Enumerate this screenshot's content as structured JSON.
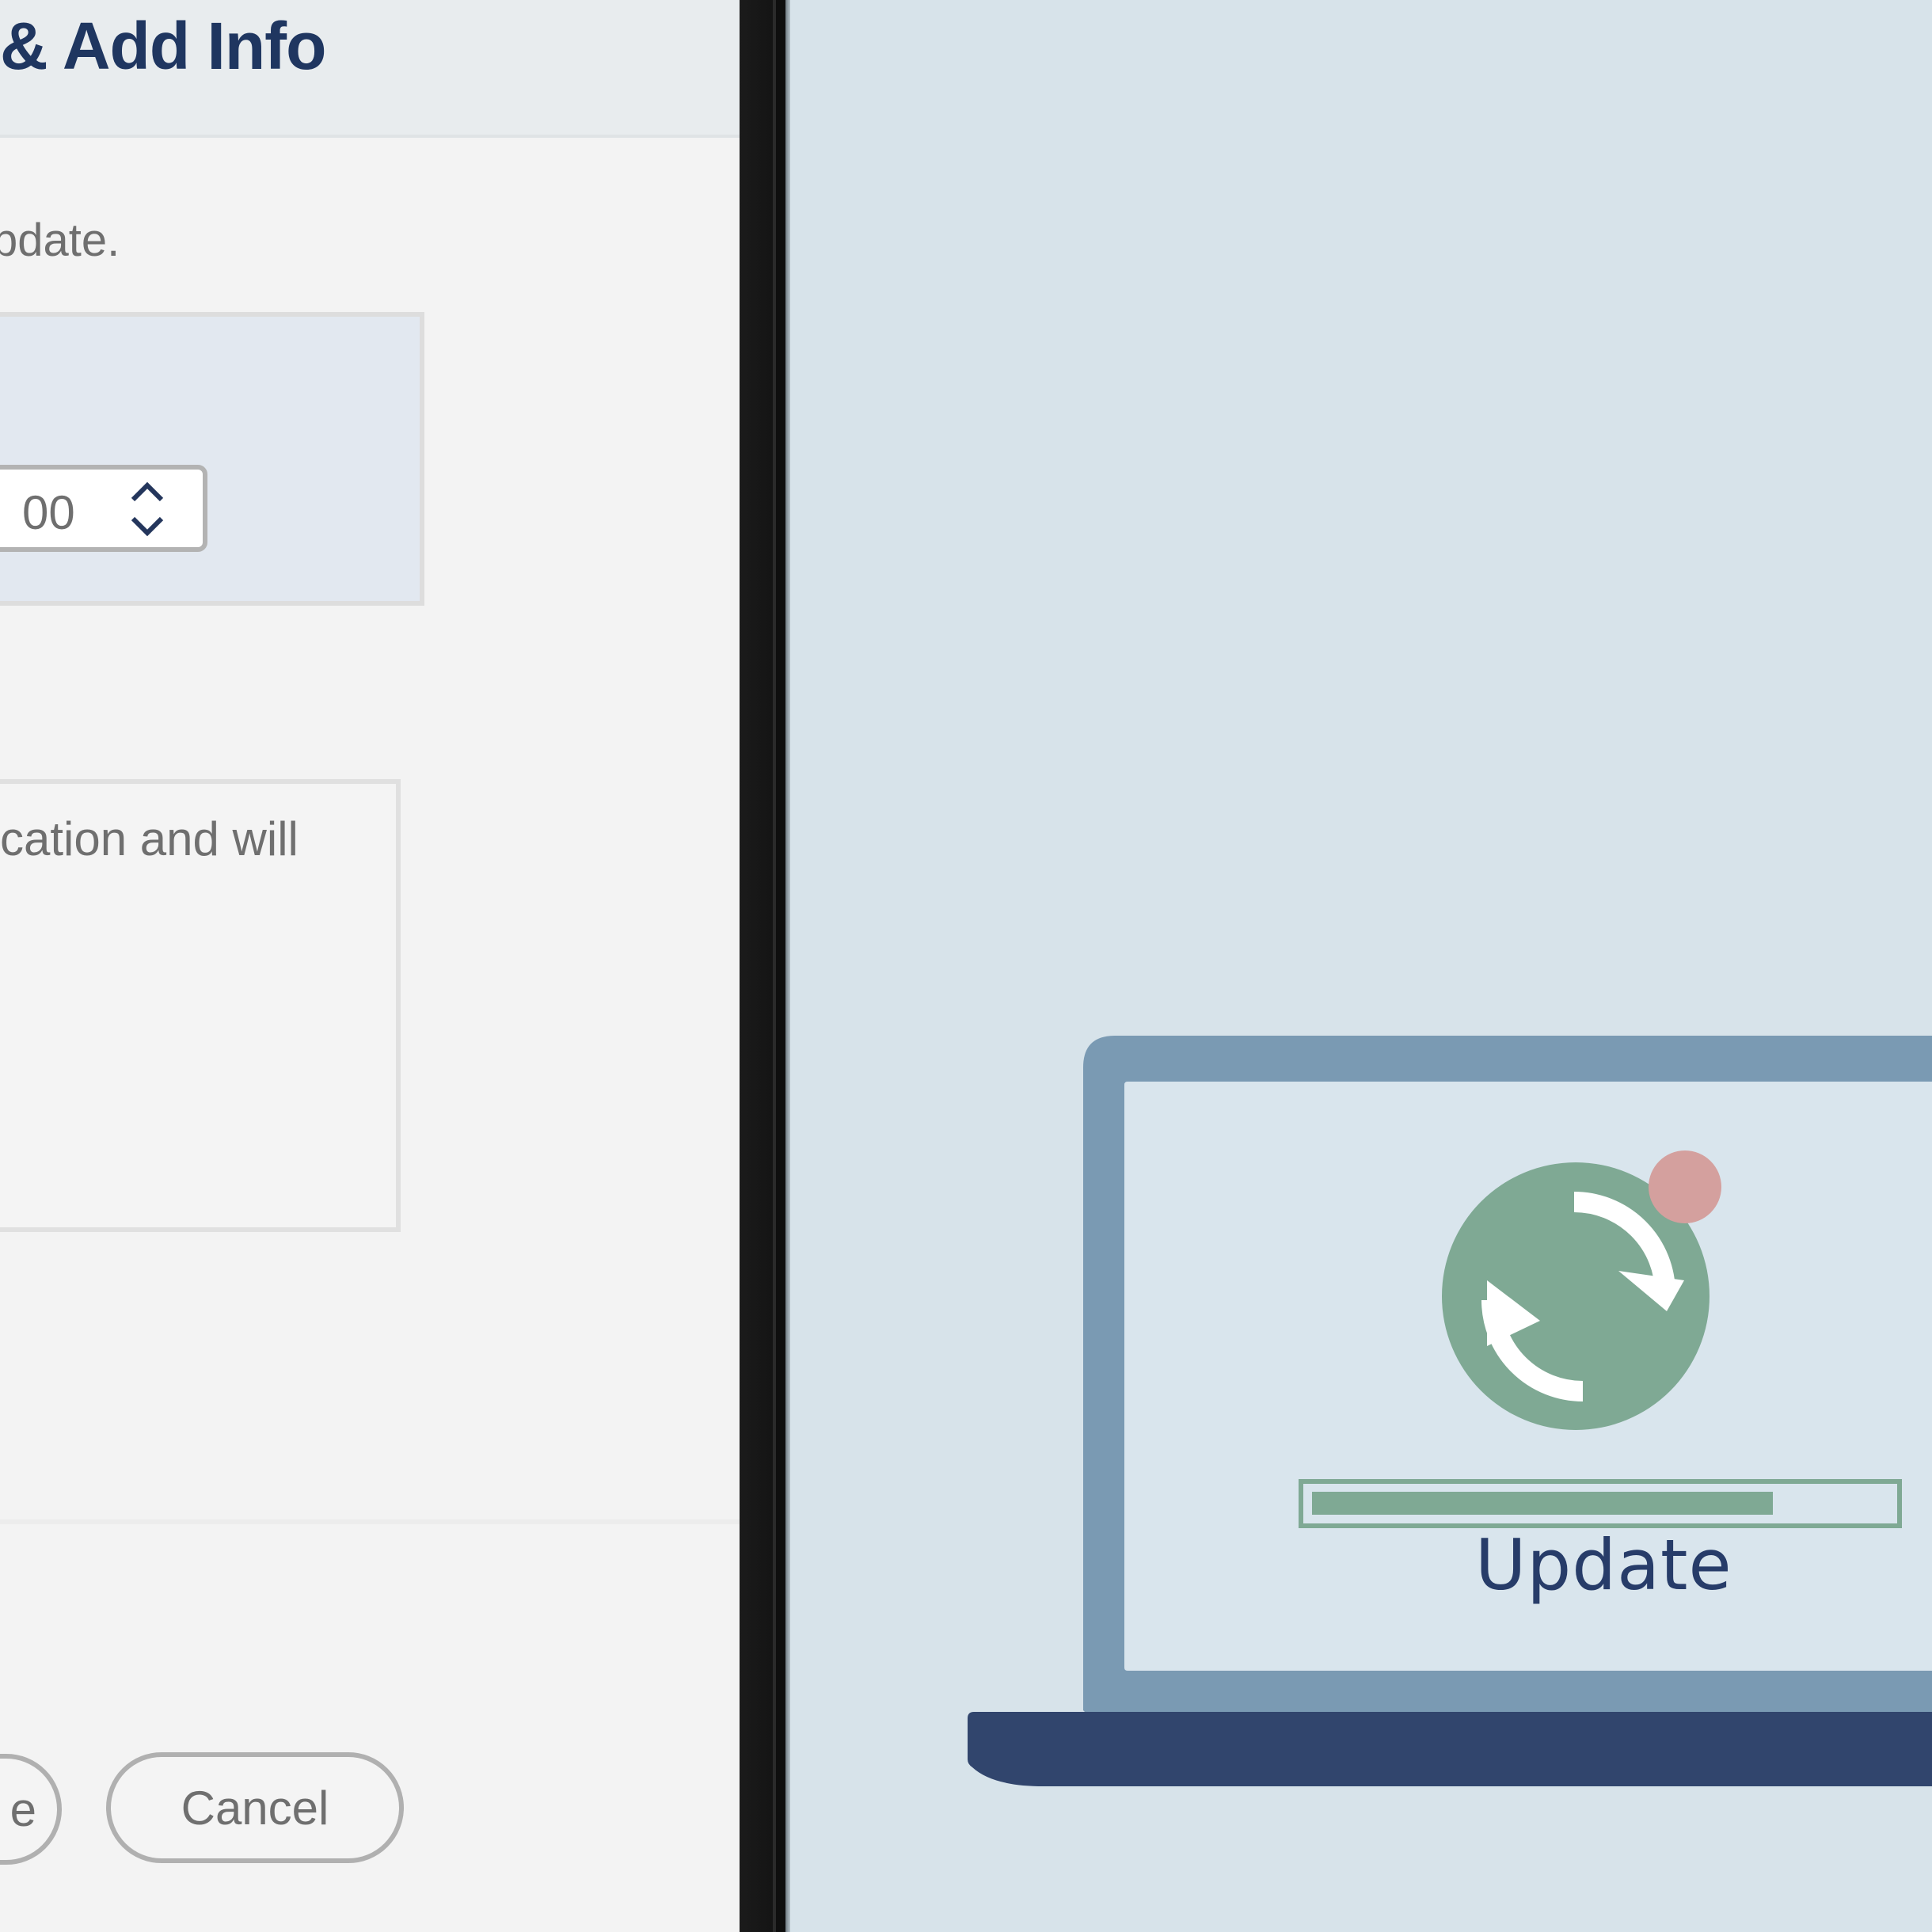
{
  "dialog": {
    "title": "& Add Info",
    "intro_text": "pdate.",
    "time": {
      "value": "00"
    },
    "notes_text": "cation and will",
    "buttons": {
      "save_label": "e",
      "cancel_label": "Cancel"
    }
  },
  "illustration": {
    "label": "Update",
    "progress": 0.8,
    "colors": {
      "background": "#d7e3ea",
      "laptop_frame": "#7a9ab3",
      "laptop_base": "#31456d",
      "screen": "#d9e5ed",
      "sync_circle": "#7fa994",
      "notification_dot": "#d4a09e",
      "label": "#273c69"
    },
    "icons": [
      "laptop-icon",
      "sync-icon",
      "notification-dot"
    ]
  }
}
